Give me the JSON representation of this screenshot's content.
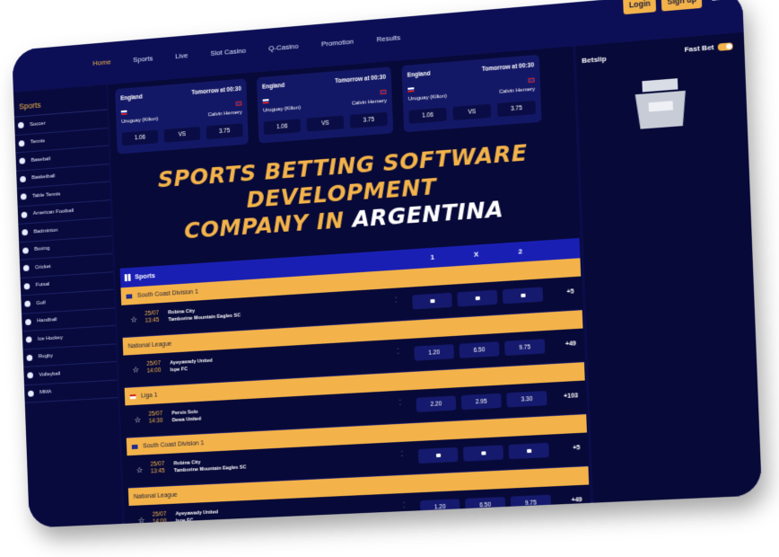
{
  "header": {
    "nav": [
      "Home",
      "Sports",
      "Live",
      "Slot Casino",
      "Q-Casino",
      "Promotion",
      "Results"
    ],
    "login": "Login",
    "signup": "Sign up",
    "language": "EN"
  },
  "sidebar": {
    "title": "Sports",
    "items": [
      "Soccer",
      "Tennis",
      "Baseball",
      "Basketball",
      "Table Tennis",
      "American Football",
      "Badminton",
      "Boxing",
      "Cricket",
      "Futsal",
      "Golf",
      "Handball",
      "Ice Hockey",
      "Rugby",
      "Volleyball",
      "MMA"
    ]
  },
  "featured": [
    {
      "league": "England",
      "when": "Tomorrow at 00:30",
      "home": "Uruguay (Kilion)",
      "away": "Calvin Hemery",
      "odd1": "1.06",
      "vs": "VS",
      "odd2": "3.75"
    },
    {
      "league": "England",
      "when": "Tomorrow at 00:30",
      "home": "Uruguay (Kilion)",
      "away": "Calvin Hemery",
      "odd1": "1.06",
      "vs": "VS",
      "odd2": "3.75"
    },
    {
      "league": "England",
      "when": "Tomorrow at 00:30",
      "home": "Uruguay (Kilion)",
      "away": "Calvin Hemery",
      "odd1": "1.06",
      "vs": "VS",
      "odd2": "3.75"
    }
  ],
  "headline": {
    "line1": "SPORTS BETTING SOFTWARE DEVELOPMENT",
    "line2_prefix": "COMPANY IN ",
    "line2_highlight": "ARGENTINA"
  },
  "table": {
    "title": "Sports",
    "col1": "1",
    "colx": "X",
    "col2": "2",
    "groups": [
      {
        "league": "South Coast Division 1",
        "date": "25/07",
        "time": "13:45",
        "team1": "Robina City",
        "team2": "Tamborine Mountain Eagles SC",
        "o1": "",
        "ox": "",
        "o2": "",
        "more": "+5",
        "locked": true
      },
      {
        "league": "National League",
        "date": "25/07",
        "time": "14:00",
        "team1": "Ayeyawady United",
        "team2": "Ispe FC",
        "o1": "1.20",
        "ox": "6.50",
        "o2": "9.75",
        "more": "+49",
        "locked": false
      },
      {
        "league": "Liga 1",
        "date": "25/07",
        "time": "14:30",
        "team1": "Persis Solo",
        "team2": "Dewa United",
        "o1": "2.20",
        "ox": "2.95",
        "o2": "3.30",
        "more": "+103",
        "locked": false
      },
      {
        "league": "South Coast Division 1",
        "date": "25/07",
        "time": "13:45",
        "team1": "Robina City",
        "team2": "Tamborine Mountain Eagles SC",
        "o1": "",
        "ox": "",
        "o2": "",
        "more": "+5",
        "locked": true
      },
      {
        "league": "National League",
        "date": "25/07",
        "time": "14:00",
        "team1": "Ayeyawady United",
        "team2": "Ispe FC",
        "o1": "1.20",
        "ox": "6.50",
        "o2": "9.75",
        "more": "+49",
        "locked": false
      }
    ]
  },
  "betslip": {
    "title": "Betslip",
    "fast_bet": "Fast Bet"
  },
  "colors": {
    "accent": "#f3b34a",
    "background": "#0b0d4a",
    "header_bar": "#1a1fb4"
  }
}
